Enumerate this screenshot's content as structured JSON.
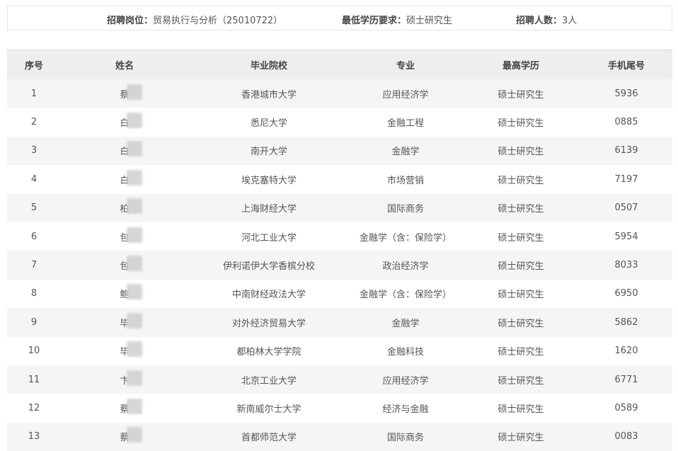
{
  "info": {
    "position_label": "招聘岗位：",
    "position_value": "贸易执行与分析（25010722）",
    "education_label": "最低学历要求：",
    "education_value": "硕士研究生",
    "count_label": "招聘人数：",
    "count_value": "3人"
  },
  "table": {
    "headers": [
      "序号",
      "姓名",
      "毕业院校",
      "专业",
      "最高学历",
      "手机尾号"
    ],
    "rows": [
      {
        "no": "1",
        "name": "蔡",
        "school": "香港城市大学",
        "major": "应用经济学",
        "degree": "硕士研究生",
        "phone": "5936"
      },
      {
        "no": "2",
        "name": "白",
        "school": "悉尼大学",
        "major": "金融工程",
        "degree": "硕士研究生",
        "phone": "0885"
      },
      {
        "no": "3",
        "name": "白",
        "school": "南开大学",
        "major": "金融学",
        "degree": "硕士研究生",
        "phone": "6139"
      },
      {
        "no": "4",
        "name": "白",
        "school": "埃克塞特大学",
        "major": "市场营销",
        "degree": "硕士研究生",
        "phone": "7197"
      },
      {
        "no": "5",
        "name": "柏",
        "school": "上海财经大学",
        "major": "国际商务",
        "degree": "硕士研究生",
        "phone": "0507"
      },
      {
        "no": "6",
        "name": "包",
        "school": "河北工业大学",
        "major": "金融学（含：保险学）",
        "degree": "硕士研究生",
        "phone": "5954"
      },
      {
        "no": "7",
        "name": "包",
        "school": "伊利诺伊大学香槟分校",
        "major": "政治经济学",
        "degree": "硕士研究生",
        "phone": "8033"
      },
      {
        "no": "8",
        "name": "鲍",
        "school": "中南财经政法大学",
        "major": "金融学（含：保险学）",
        "degree": "硕士研究生",
        "phone": "6950"
      },
      {
        "no": "9",
        "name": "毕",
        "school": "对外经济贸易大学",
        "major": "金融学",
        "degree": "硕士研究生",
        "phone": "5862"
      },
      {
        "no": "10",
        "name": "毕",
        "school": "都柏林大学学院",
        "major": "金融科技",
        "degree": "硕士研究生",
        "phone": "1620"
      },
      {
        "no": "11",
        "name": "卞",
        "school": "北京工业大学",
        "major": "应用经济学",
        "degree": "硕士研究生",
        "phone": "6771"
      },
      {
        "no": "12",
        "name": "蔡",
        "school": "新南威尔士大学",
        "major": "经济与金融",
        "degree": "硕士研究生",
        "phone": "0589"
      },
      {
        "no": "13",
        "name": "蔡",
        "school": "首都师范大学",
        "major": "国际商务",
        "degree": "硕士研究生",
        "phone": "0083"
      }
    ]
  }
}
